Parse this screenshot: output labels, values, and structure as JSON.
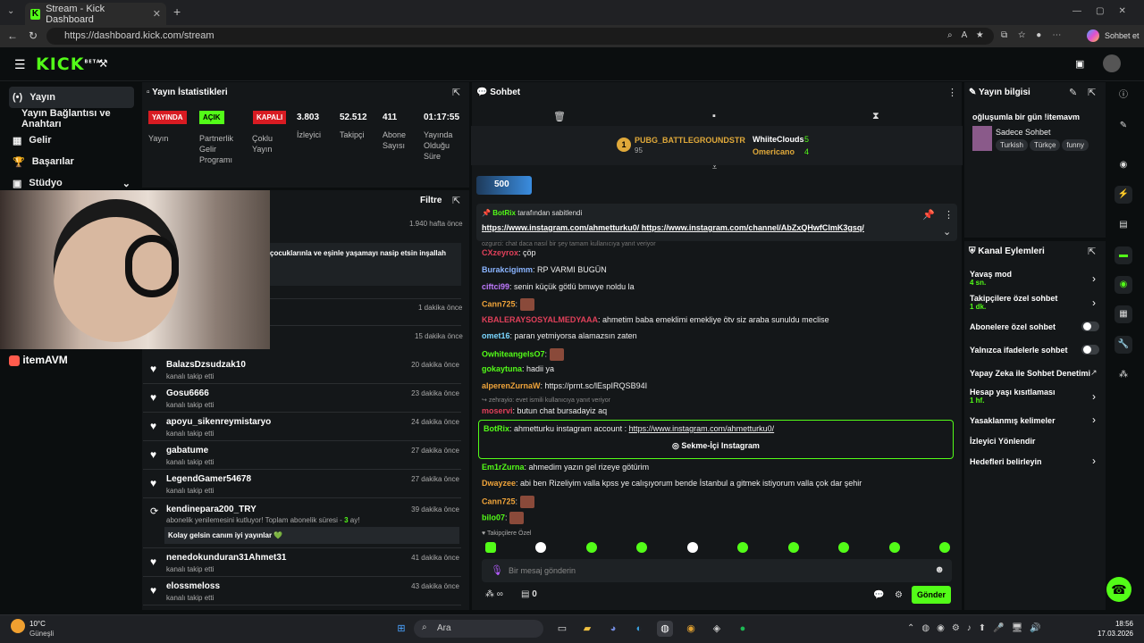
{
  "browser": {
    "tab_title": "Stream - Kick Dashboard",
    "url": "https://dashboard.kick.com/stream",
    "copilot_label": "Sohbet et"
  },
  "kick": {
    "logo": "KICK",
    "beta": "BETA"
  },
  "nav": {
    "items": [
      "Yayın",
      "Yayın Bağlantısı ve Anahtarı",
      "Gelir",
      "Başarılar",
      "Stüdyo"
    ]
  },
  "stats": {
    "title": "Yayın İstatistikleri",
    "badges": [
      "YAYINDA",
      "AÇIK",
      "KAPALI"
    ],
    "labels": [
      "Yayın",
      "Partnerlik Gelir Programı",
      "Çoklu Yayın",
      "İzleyici",
      "Takipçi",
      "Abone Sayısı",
      "Yayında Olduğu Süre"
    ],
    "values": [
      "3.803",
      "52.512",
      "411",
      "01:17:55"
    ]
  },
  "activity": {
    "filter_label": "Filtre",
    "first_time": "1.940 hafta önce",
    "partial_msg": "çocuklarınla ve eşinle yaşamayı nasip etsin inşallah",
    "times": [
      "1 dakika önce",
      "15 dakika önce"
    ],
    "items": [
      {
        "name": "BalazsDzsudzak10",
        "sub": "kanalı takip etti",
        "time": "20 dakika önce"
      },
      {
        "name": "Gosu6666",
        "sub": "kanalı takip etti",
        "time": "23 dakika önce"
      },
      {
        "name": "apoyu_sikenreymistaryo",
        "sub": "kanalı takip etti",
        "time": "24 dakika önce"
      },
      {
        "name": "gabatume",
        "sub": "kanalı takip etti",
        "time": "27 dakika önce"
      },
      {
        "name": "LegendGamer54678",
        "sub": "kanalı takip etti",
        "time": "27 dakika önce"
      }
    ],
    "resub": {
      "name": "kendinepara200_TRY",
      "text": "abonelik yenilemesini kutluyor! Toplam abonelik süresi -",
      "months": "3",
      "suffix": "ay!",
      "time": "39 dakika önce",
      "message": "Kolay gelsin canım iyi yayınlar 💚"
    },
    "items2": [
      {
        "name": "nenedokunduran31Ahmet31",
        "sub": "kanalı takip etti",
        "time": "41 dakika önce"
      },
      {
        "name": "elossmeloss",
        "sub": "kanalı takip etti",
        "time": "43 dakika önce"
      }
    ],
    "sponsor": "itemAVM"
  },
  "chat": {
    "title": "Sohbet",
    "leaderboard": [
      {
        "rank": "1",
        "name": "PUBG_BATTLEGROUNDSTR",
        "pts": "95"
      },
      {
        "name": "WhiiteClouds",
        "pts": "5"
      },
      {
        "name": "Omericano",
        "pts": "4"
      }
    ],
    "gift_count": "500",
    "pinned": {
      "by": "BotRix",
      "by_suffix": "tarafından sabitlendi",
      "link1": "https://www.instagram.com/ahmetturku0/",
      "link2": "https://www.instagram.com/channel/AbZxQHwfClmK3gsq/"
    },
    "messages": [
      {
        "user": "CXzeyrox",
        "text": "çöp",
        "color": "#e0405a"
      },
      {
        "user": "Burakcigimm",
        "text": "RP VARMI BUGÜN",
        "color": "#8ab4ff"
      },
      {
        "user": "ciftci99",
        "text": "senin küçük götlü bmwye noldu la",
        "color": "#c07aff"
      },
      {
        "user": "Cann725",
        "text": "",
        "color": "#f0a43a"
      },
      {
        "user": "KBALERAYSOSYALMEDYAAA",
        "text": "ahmetim baba emeklimi emekliye ötv siz araba sunuldu meclise",
        "color": "#e0405a"
      },
      {
        "user": "omet16",
        "text": "paran yetmiyorsa alamazsın zaten",
        "color": "#7ad6ff"
      },
      {
        "user": "OwhiteangelsO7",
        "text": "",
        "color": "#53fc18"
      },
      {
        "user": "gokaytuna",
        "text": "hadii ya",
        "color": "#53fc18"
      },
      {
        "user": "alperenZurnaW",
        "text": "https://prnt.sc/lEspIRQSB94I",
        "color": "#f0a43a"
      }
    ],
    "reply_hint": "zehrayio: evet ismili kullanıcıya yanıt veriyor",
    "reply_hint_top": "ozgurci: chat daca nasıl bir şey tamam kullanıcıya yanıt veriyor",
    "msg_moservi": {
      "user": "moservi",
      "text": "butun chat bursadayiz aq",
      "color": "#e0405a"
    },
    "bot_msg": {
      "user": "BotRix",
      "text": "ahmetturku instagram account :",
      "link": "https://www.instagram.com/ahmetturku0/",
      "button": "Sekme-İçi Instagram"
    },
    "messages2": [
      {
        "user": "Em1rZurna",
        "text": "ahmedim yazın gel rizeye götürim",
        "color": "#53fc18"
      },
      {
        "user": "Dwayzee",
        "text": "abi ben Rizeliyim valla kpss ye calışıyorum bende İstanbul a gitmek istiyorum valla çok dar şehir",
        "color": "#f0a43a"
      },
      {
        "user": "Cann725",
        "text": "",
        "color": "#f0a43a"
      },
      {
        "user": "bilo07",
        "text": "",
        "color": "#53fc18"
      }
    ],
    "followers_only": "Takipçilere Özel",
    "input_placeholder": "Bir mesaj gönderin",
    "send_label": "Gönder",
    "footer_count": "0"
  },
  "info": {
    "title": "Yayın bilgisi",
    "stream_title": "oğluşumla bir gün !itemavm",
    "category": "Sadece Sohbet",
    "tags": [
      "Turkish",
      "Türkçe",
      "funny"
    ]
  },
  "actions": {
    "title": "Kanal Eylemleri",
    "slow": {
      "label": "Yavaş mod",
      "value": "4 sn."
    },
    "follower_chat": {
      "label": "Takipçilere özel sohbet",
      "value": "1 dk."
    },
    "sub_chat": "Abonelere özel sohbet",
    "emote_chat": "Yalnızca ifadelerle sohbet",
    "ai_mod": "Yapay Zeka ile Sohbet Denetimi",
    "age": {
      "label": "Hesap yaşı kısıtlaması",
      "value": "1 hf."
    },
    "banned": "Yasaklanmış kelimeler",
    "redirect": "İzleyici Yönlendir",
    "goals": "Hedefleri belirleyin"
  },
  "taskbar": {
    "weather_temp": "10°C",
    "weather_desc": "Güneşli",
    "search": "Ara",
    "time": "18:56",
    "date": "17.03.2026"
  }
}
